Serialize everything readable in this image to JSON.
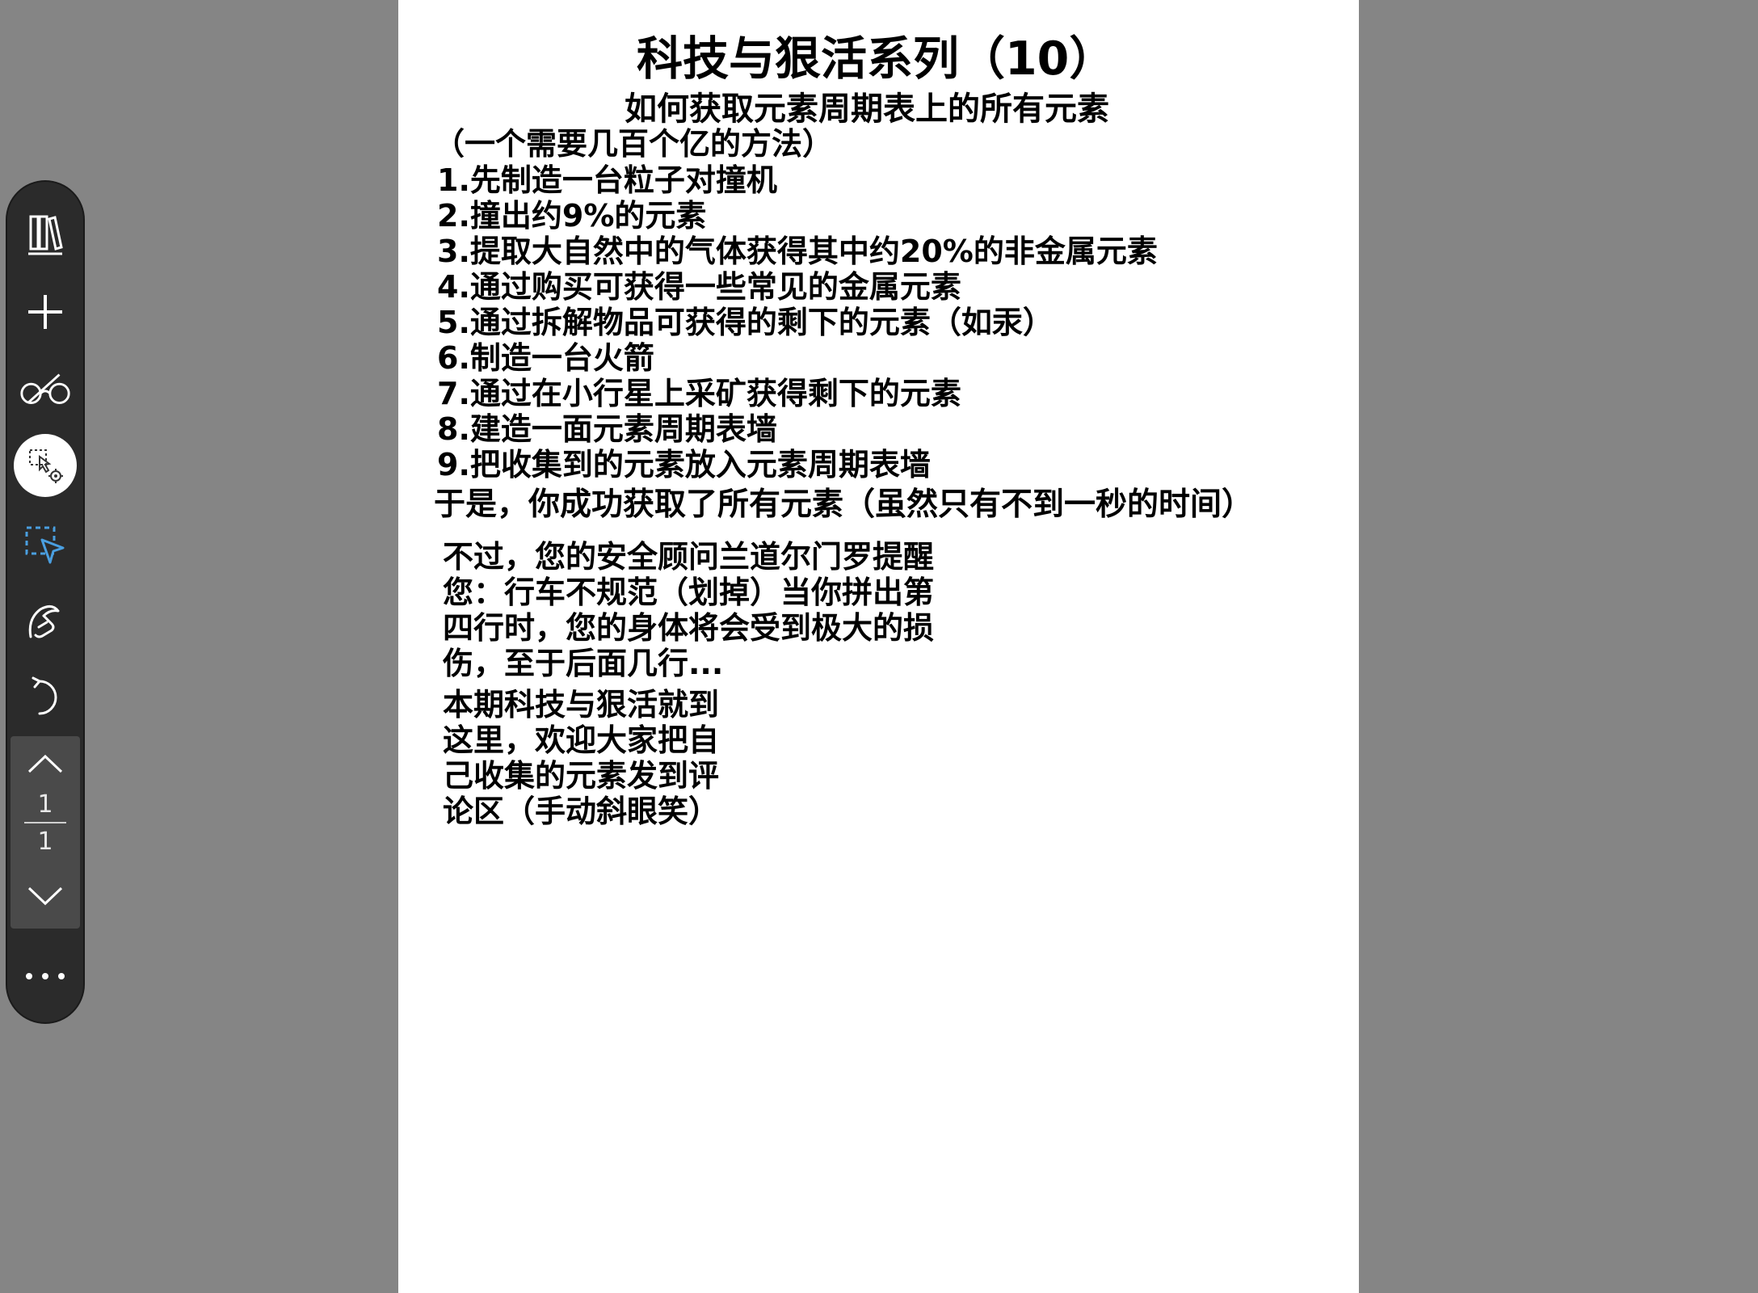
{
  "document": {
    "title": "科技与狠活系列（10）",
    "subtitle": "如何获取元素周期表上的所有元素",
    "note": "（一个需要几百个亿的方法）",
    "steps": [
      "1.先制造一台粒子对撞机",
      "2.撞出约9%的元素",
      "3.提取大自然中的气体获得其中约20%的非金属元素",
      "4.通过购买可获得一些常见的金属元素",
      "5.通过拆解物品可获得的剩下的元素（如汞）",
      "6.制造一台火箭",
      "7.通过在小行星上采矿获得剩下的元素",
      "8.建造一面元素周期表墙",
      "9.把收集到的元素放入元素周期表墙"
    ],
    "conclusion": "于是，你成功获取了所有元素（虽然只有不到一秒的时间）",
    "warning_lines": [
      "不过，您的安全顾问兰道尔门罗提醒",
      "您：行车不规范（划掉）当你拼出第",
      "四行时，您的身体将会受到极大的损",
      "伤，至于后面几行..."
    ],
    "outro_lines": [
      "本期科技与狠活就到",
      "这里，欢迎大家把自",
      "己收集的元素发到评",
      "论区（手动斜眼笑）"
    ]
  },
  "toolbar": {
    "tools": [
      {
        "name": "library",
        "icon": "books-icon"
      },
      {
        "name": "add",
        "icon": "plus-icon"
      },
      {
        "name": "reading-mode",
        "icon": "glasses-icon"
      },
      {
        "name": "select-settings",
        "icon": "selection-gear-icon"
      },
      {
        "name": "lasso-select",
        "icon": "dashed-select-pointer-icon"
      },
      {
        "name": "touch-draw",
        "icon": "finger-draw-icon"
      },
      {
        "name": "undo",
        "icon": "undo-icon"
      },
      {
        "name": "more",
        "icon": "more-dots-icon"
      }
    ],
    "page_nav": {
      "current": "1",
      "total": "1"
    }
  },
  "colors": {
    "background": "#858585",
    "page": "#ffffff",
    "toolbar": "#2b2b2b",
    "accent": "#4a9fe0"
  }
}
